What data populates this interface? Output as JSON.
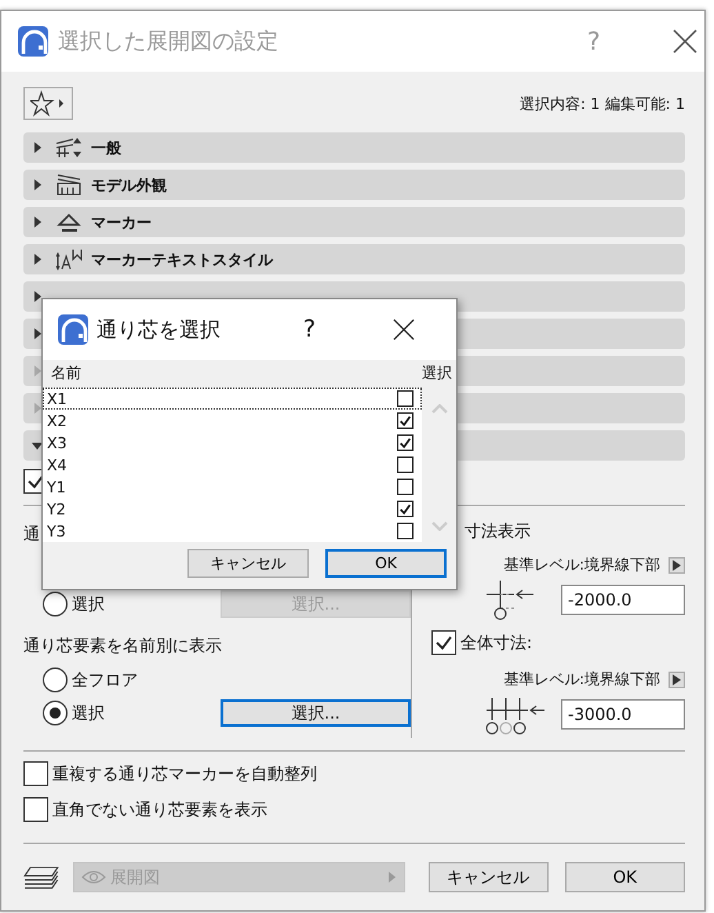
{
  "window": {
    "title": "選択した展開図の設定",
    "help": "?"
  },
  "toolbar": {
    "selection_info": "選択内容: 1 編集可能: 1"
  },
  "sections": [
    {
      "label": "一般",
      "expanded": false,
      "disabled": false
    },
    {
      "label": "モデル外観",
      "expanded": false,
      "disabled": false
    },
    {
      "label": "マーカー",
      "expanded": false,
      "disabled": false
    },
    {
      "label": "マーカーテキストスタイル",
      "expanded": false,
      "disabled": false
    },
    {
      "expanded": false,
      "disabled": false
    },
    {
      "expanded": false,
      "disabled": false
    },
    {
      "expanded": false,
      "disabled": true
    },
    {
      "expanded": false,
      "disabled": true
    },
    {
      "expanded": true,
      "disabled": false
    }
  ],
  "top_checkbox": {
    "checked": true
  },
  "left_panel": {
    "group_label": "通",
    "first_choice": {
      "label": "選択",
      "selected": false,
      "button": {
        "label": "選択...",
        "disabled": true,
        "focused": false
      }
    },
    "by_name": {
      "label": "通り芯要素を名前別に表示",
      "options": [
        {
          "label": "全フロア",
          "selected": false
        },
        {
          "label": "選択",
          "selected": true,
          "button": {
            "label": "選択...",
            "disabled": false,
            "focused": true
          }
        }
      ]
    }
  },
  "right_panel": {
    "title": "寸法表示",
    "levels": [
      {
        "label": "基準レベル:境界線下部",
        "value": "-2000.0"
      },
      {
        "checkbox": {
          "label": "全体寸法:",
          "checked": true
        },
        "label": "基準レベル:境界線下部",
        "value": "-3000.0"
      }
    ]
  },
  "options": [
    {
      "label": "重複する通り芯マーカーを自動整列",
      "checked": false
    },
    {
      "label": "直角でない通り芯要素を表示",
      "checked": false
    }
  ],
  "footer": {
    "layer_dropdown": {
      "value": "展開図",
      "disabled": true
    },
    "buttons": [
      {
        "label": "キャンセル",
        "focused": false
      },
      {
        "label": "OK",
        "focused": false
      }
    ]
  },
  "grid_dialog": {
    "title": "通り芯を選択",
    "help": "?",
    "columns": [
      "名前",
      "選択"
    ],
    "rows": [
      {
        "name": "X1",
        "checked": false,
        "focused": true
      },
      {
        "name": "X2",
        "checked": true,
        "focused": false
      },
      {
        "name": "X3",
        "checked": true,
        "focused": false
      },
      {
        "name": "X4",
        "checked": false,
        "focused": false
      },
      {
        "name": "Y1",
        "checked": false,
        "focused": false
      },
      {
        "name": "Y2",
        "checked": true,
        "focused": false
      },
      {
        "name": "Y3",
        "checked": false,
        "focused": false
      }
    ],
    "buttons": [
      {
        "label": "キャンセル",
        "focused": false
      },
      {
        "label": "OK",
        "focused": true
      }
    ]
  }
}
